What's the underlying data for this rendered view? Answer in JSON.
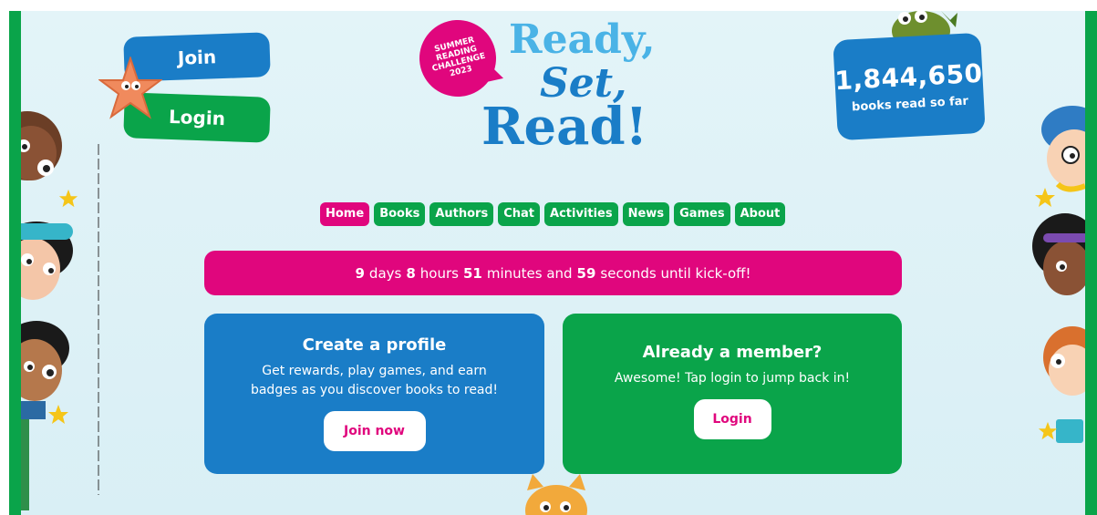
{
  "header": {
    "join_label": "Join",
    "login_label": "Login",
    "badge": [
      "SUMMER",
      "READING",
      "CHALLENGE",
      "2023"
    ],
    "logo": {
      "line1": "Ready,",
      "line2": "Set,",
      "line3": "Read!"
    },
    "counter": {
      "value": "1,844,650",
      "label": "books read so far"
    }
  },
  "nav": {
    "items": [
      "Home",
      "Books",
      "Authors",
      "Chat",
      "Activities",
      "News",
      "Games",
      "About"
    ],
    "active": "Home"
  },
  "countdown": {
    "days": "9",
    "days_label": "days",
    "hours": "8",
    "hours_label": "hours",
    "minutes": "51",
    "minutes_label": "minutes and",
    "seconds": "59",
    "seconds_label": "seconds until kick-off!"
  },
  "profile_card": {
    "title": "Create a profile",
    "text": "Get rewards, play games, and earn badges as you discover books to read!",
    "button": "Join now"
  },
  "member_card": {
    "title": "Already a member?",
    "text": "Awesome! Tap login to jump back in!",
    "button": "Login"
  },
  "colors": {
    "blue": "#1a7dc7",
    "green": "#0aa44a",
    "pink": "#e0067d",
    "light_blue": "#4ab3e6"
  }
}
